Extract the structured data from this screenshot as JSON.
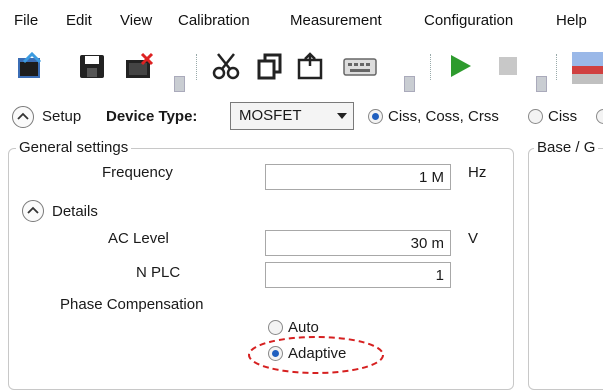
{
  "menu": [
    "File",
    "Edit",
    "View",
    "Calibration",
    "Measurement",
    "Configuration",
    "Help"
  ],
  "toolbar": {
    "icons": [
      "open-file-icon",
      "save-icon",
      "close-file-icon",
      "cut-icon",
      "copy-icon",
      "paste-icon",
      "keyboard-icon",
      "run-icon",
      "stop-icon",
      "image-icon"
    ],
    "colors": {
      "run": "#2e9b2e",
      "stop": "#c8c8c8"
    }
  },
  "setup": {
    "label": "Setup",
    "device_type_label": "Device Type:",
    "device_type_value": "MOSFET",
    "options": [
      "Ciss, Coss, Crss",
      "Ciss"
    ],
    "selected": "Ciss, Coss, Crss"
  },
  "general": {
    "title": "General settings",
    "frequency": {
      "label": "Frequency",
      "value": "1 M",
      "unit": "Hz"
    },
    "details_label": "Details",
    "ac_level": {
      "label": "AC Level",
      "value": "30 m",
      "unit": "V"
    },
    "nplc": {
      "label": "N PLC",
      "value": "1"
    },
    "phase_comp": {
      "label": "Phase Compensation",
      "options": [
        "Auto",
        "Adaptive"
      ],
      "selected": "Adaptive"
    }
  },
  "right_group": {
    "title": "Base / G"
  },
  "highlight_color": "#d62020"
}
